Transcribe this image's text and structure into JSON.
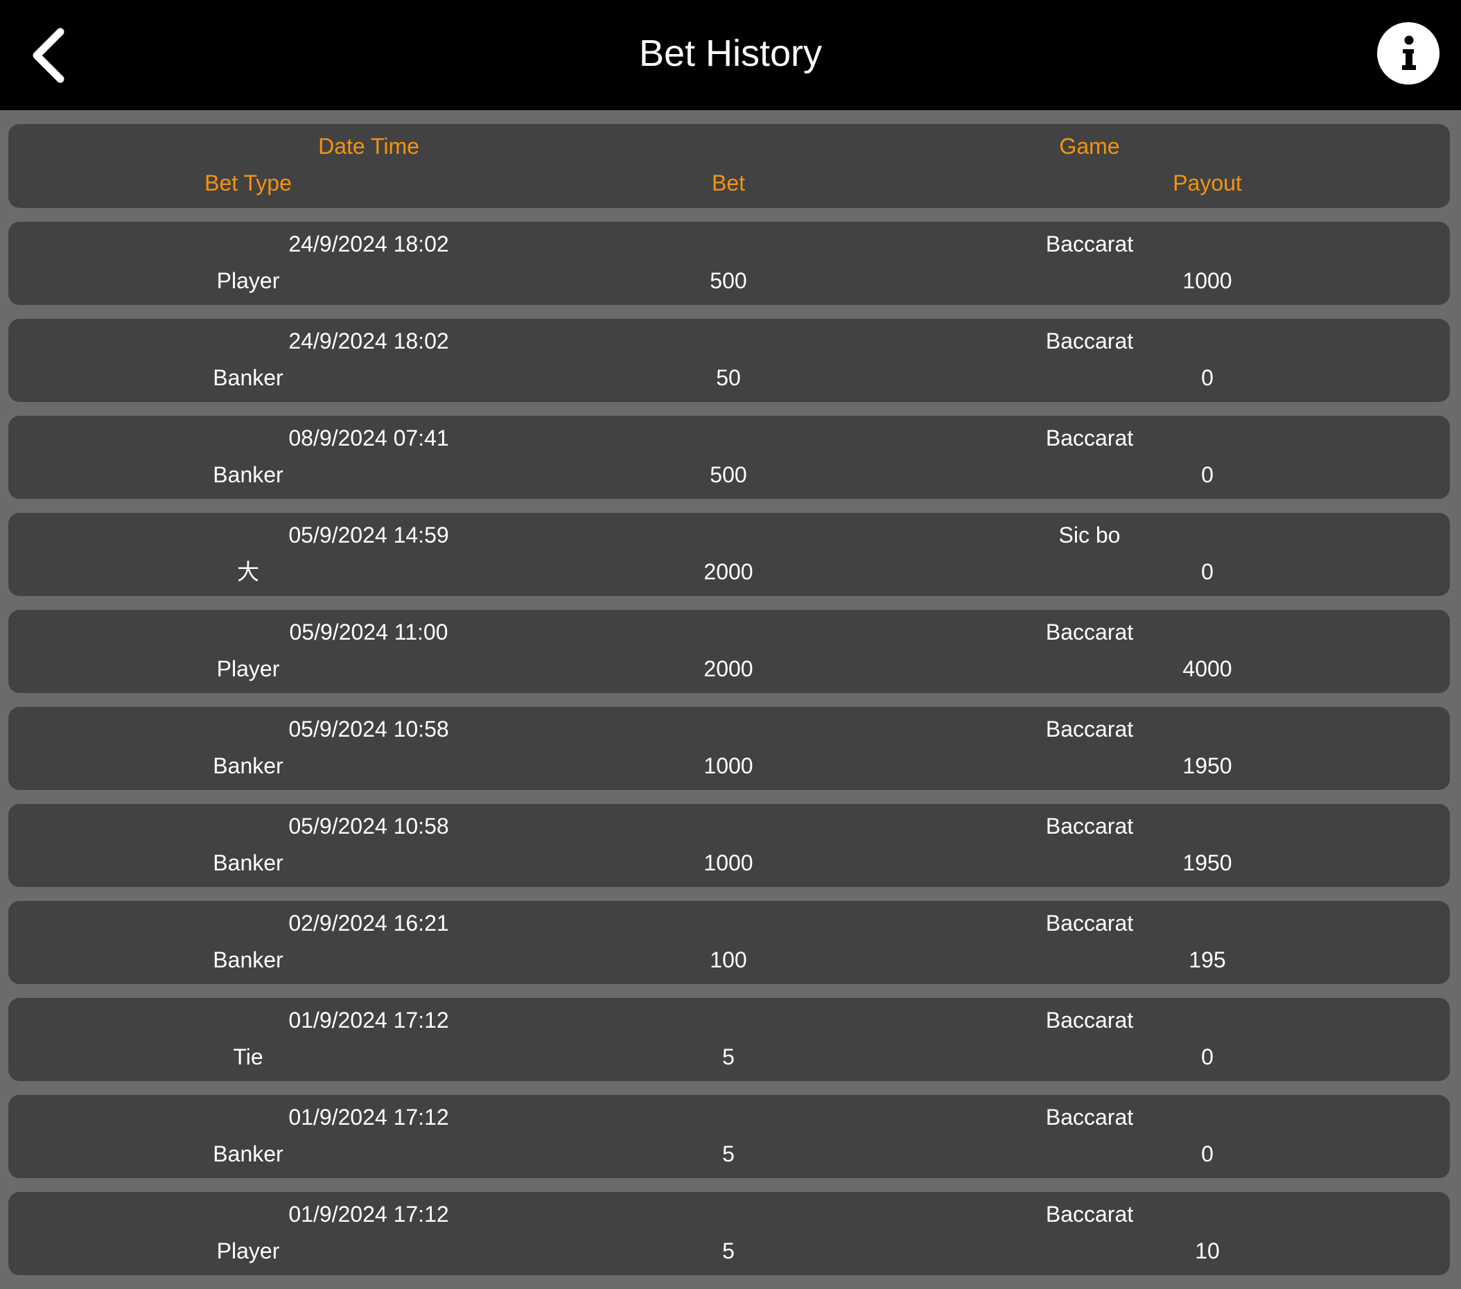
{
  "header": {
    "title": "Bet History"
  },
  "columns": {
    "date_time": "Date Time",
    "game": "Game",
    "bet_type": "Bet Type",
    "bet": "Bet",
    "payout": "Payout"
  },
  "rows": [
    {
      "date_time": "24/9/2024 18:02",
      "game": "Baccarat",
      "bet_type": "Player",
      "bet": "500",
      "payout": "1000"
    },
    {
      "date_time": "24/9/2024 18:02",
      "game": "Baccarat",
      "bet_type": "Banker",
      "bet": "50",
      "payout": "0"
    },
    {
      "date_time": "08/9/2024 07:41",
      "game": "Baccarat",
      "bet_type": "Banker",
      "bet": "500",
      "payout": "0"
    },
    {
      "date_time": "05/9/2024 14:59",
      "game": "Sic bo",
      "bet_type": "大",
      "bet": "2000",
      "payout": "0"
    },
    {
      "date_time": "05/9/2024 11:00",
      "game": "Baccarat",
      "bet_type": "Player",
      "bet": "2000",
      "payout": "4000"
    },
    {
      "date_time": "05/9/2024 10:58",
      "game": "Baccarat",
      "bet_type": "Banker",
      "bet": "1000",
      "payout": "1950"
    },
    {
      "date_time": "05/9/2024 10:58",
      "game": "Baccarat",
      "bet_type": "Banker",
      "bet": "1000",
      "payout": "1950"
    },
    {
      "date_time": "02/9/2024 16:21",
      "game": "Baccarat",
      "bet_type": "Banker",
      "bet": "100",
      "payout": "195"
    },
    {
      "date_time": "01/9/2024 17:12",
      "game": "Baccarat",
      "bet_type": "Tie",
      "bet": "5",
      "payout": "0"
    },
    {
      "date_time": "01/9/2024 17:12",
      "game": "Baccarat",
      "bet_type": "Banker",
      "bet": "5",
      "payout": "0"
    },
    {
      "date_time": "01/9/2024 17:12",
      "game": "Baccarat",
      "bet_type": "Player",
      "bet": "5",
      "payout": "10"
    }
  ],
  "colors": {
    "header_bar": "#000000",
    "background": "#6b6b6b",
    "card": "#424242",
    "header_text": "#f5930f",
    "text": "#ffffff"
  },
  "icons": {
    "back": "chevron-left-icon",
    "info": "info-icon"
  }
}
